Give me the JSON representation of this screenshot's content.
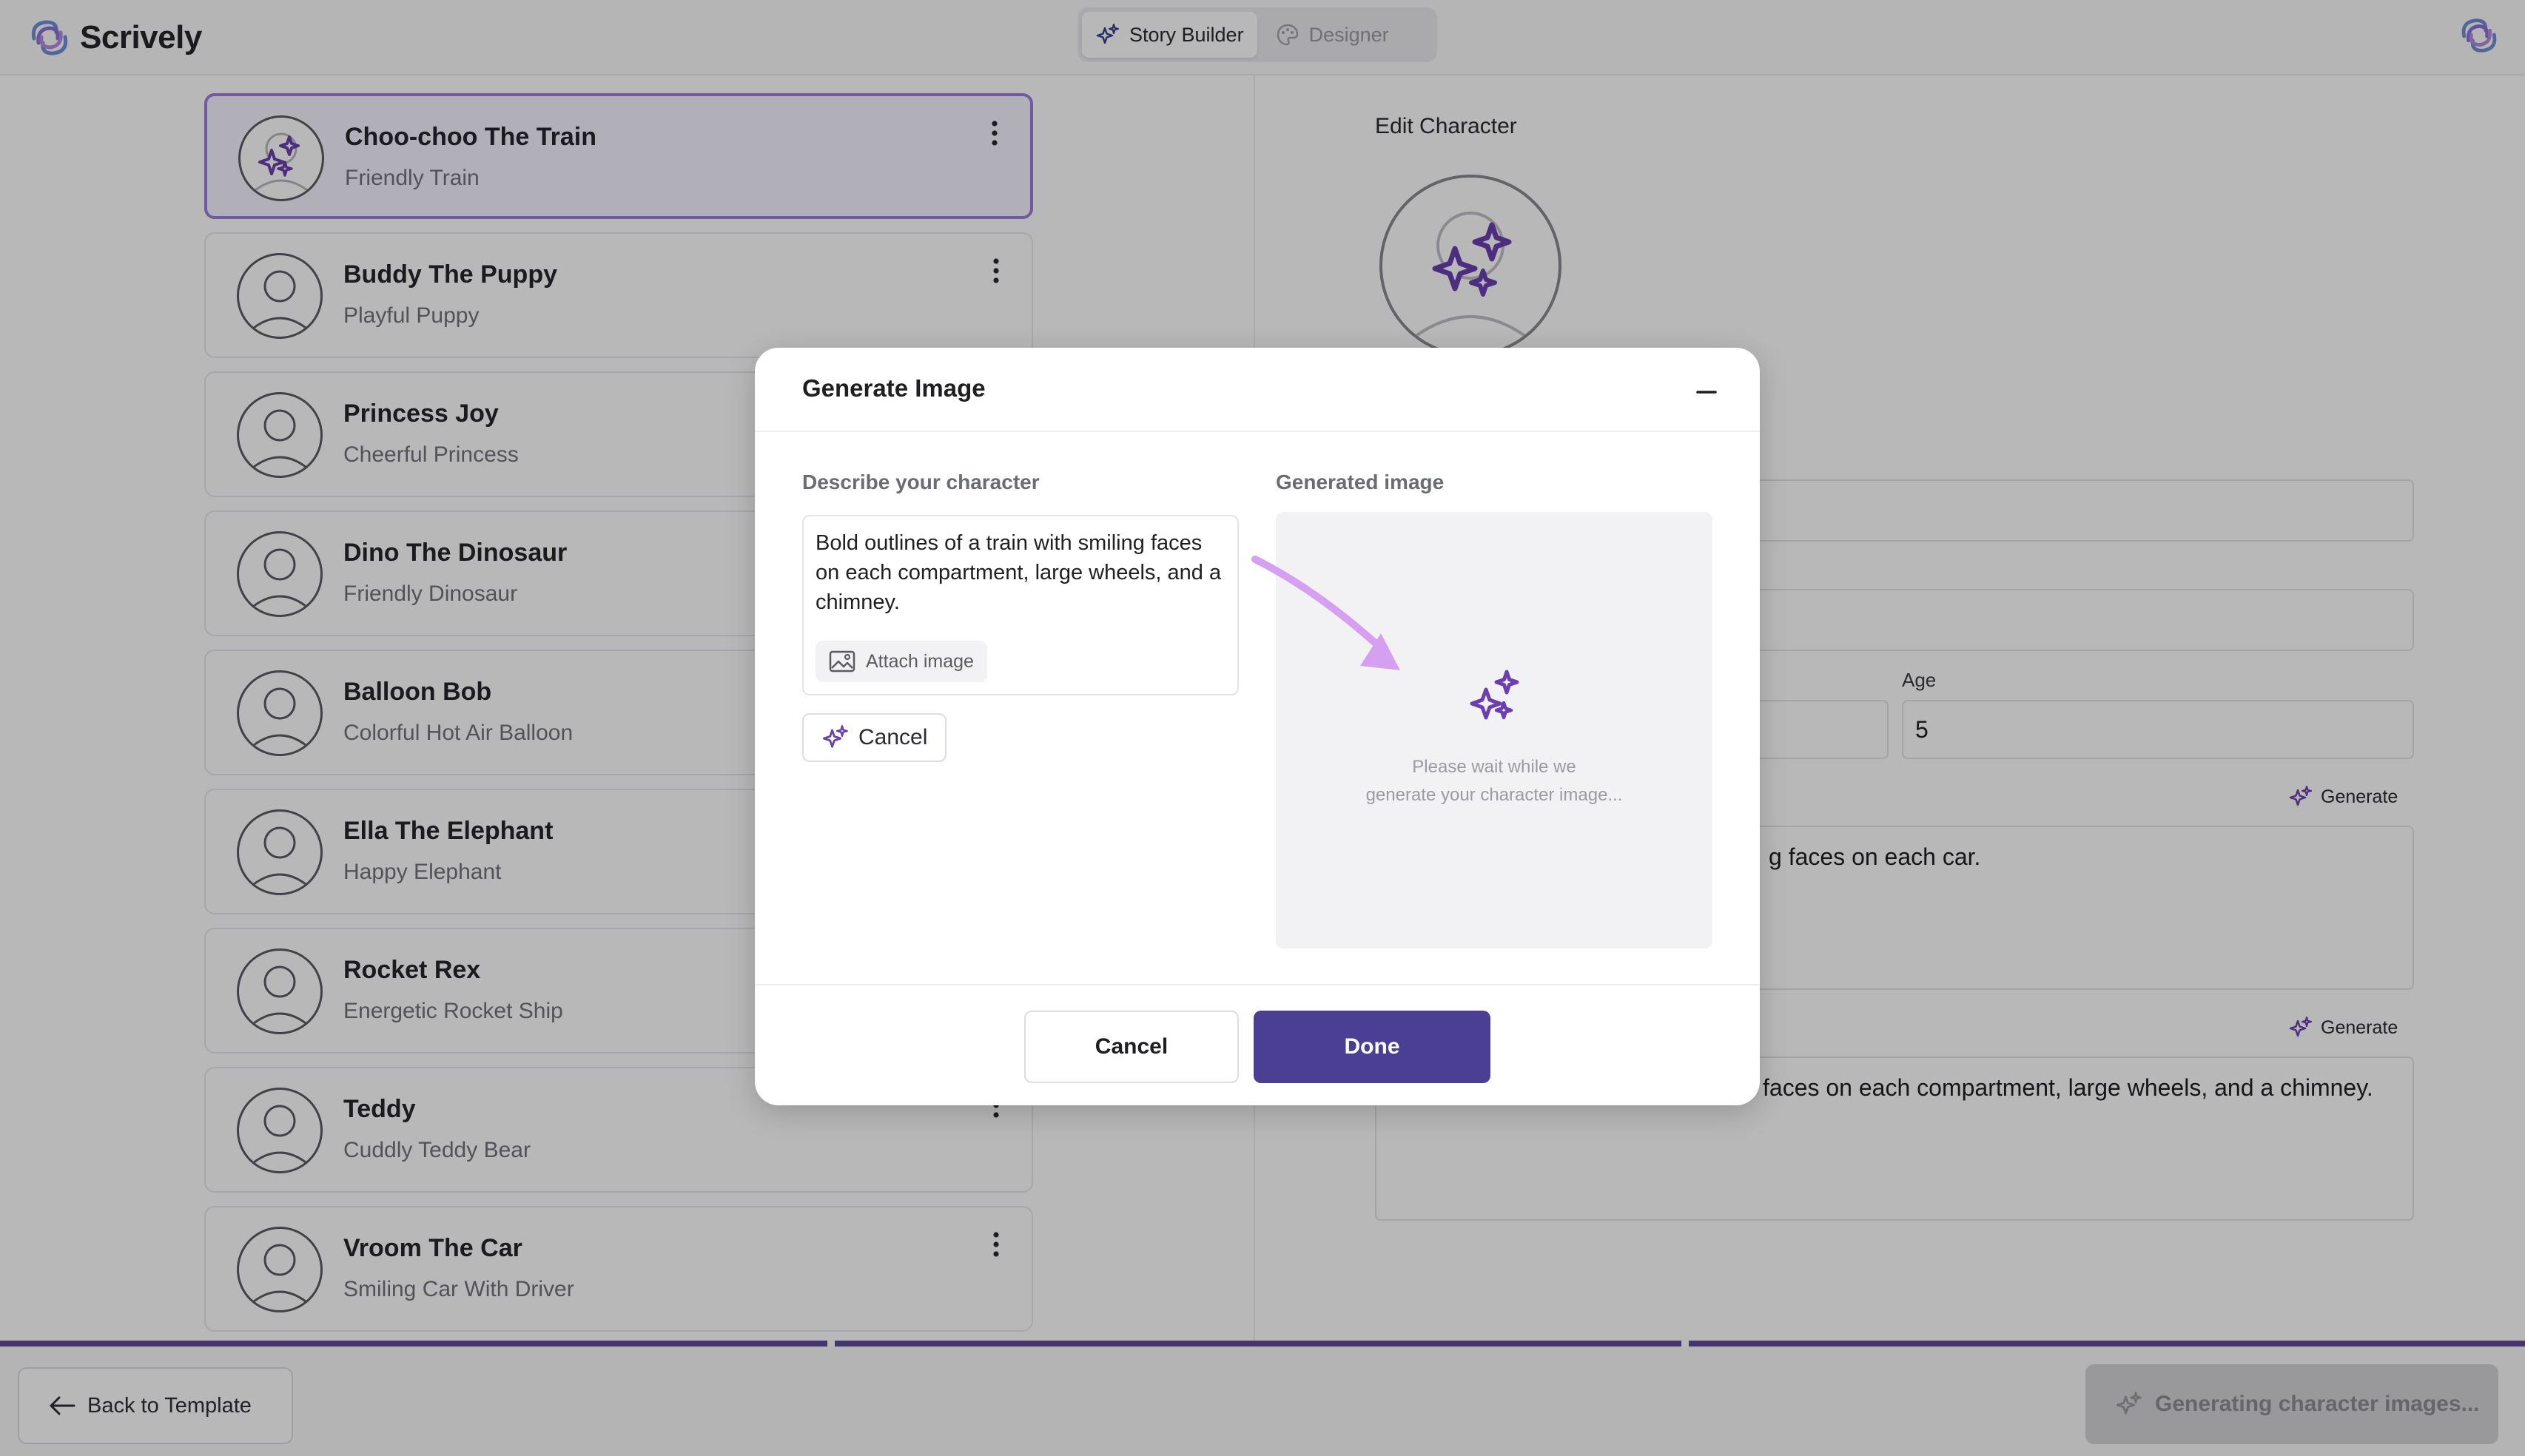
{
  "header": {
    "brand": "Scrively",
    "tabs": [
      {
        "label": "Story Builder",
        "active": true
      },
      {
        "label": "Designer",
        "active": false
      }
    ]
  },
  "characters": [
    {
      "name": "Choo-choo The Train",
      "subtitle": "Friendly Train",
      "selected": true
    },
    {
      "name": "Buddy The Puppy",
      "subtitle": "Playful Puppy"
    },
    {
      "name": "Princess Joy",
      "subtitle": "Cheerful Princess"
    },
    {
      "name": "Dino The Dinosaur",
      "subtitle": "Friendly Dinosaur"
    },
    {
      "name": "Balloon Bob",
      "subtitle": "Colorful Hot Air Balloon"
    },
    {
      "name": "Ella The Elephant",
      "subtitle": "Happy Elephant"
    },
    {
      "name": "Rocket Rex",
      "subtitle": "Energetic Rocket Ship"
    },
    {
      "name": "Teddy",
      "subtitle": "Cuddly Teddy Bear"
    },
    {
      "name": "Vroom The Car",
      "subtitle": "Smiling Car With Driver"
    }
  ],
  "edit_panel": {
    "title": "Edit Character",
    "age_label": "Age",
    "age_value": "5",
    "generate_label": "Generate",
    "description_partial": "g faces on each car.",
    "prompt_partial": "faces on each compartment, large wheels, and a chimney."
  },
  "footer": {
    "back_label": "Back to Template",
    "status_label": "Generating character images..."
  },
  "modal": {
    "title": "Generate Image",
    "describe_label": "Describe your character",
    "description": "Bold outlines of a train with smiling faces on each compartment, large wheels, and a chimney.",
    "attach_label": "Attach image",
    "cancel_small_label": "Cancel",
    "generated_label": "Generated image",
    "wait_line1": "Please wait while we",
    "wait_line2": "generate your character image...",
    "cancel_label": "Cancel",
    "done_label": "Done"
  },
  "colors": {
    "accent": "#4b3f94",
    "sparkle": "#6b3fb0",
    "selected_border": "#9b7ee0",
    "arrow": "#d59ff2"
  }
}
